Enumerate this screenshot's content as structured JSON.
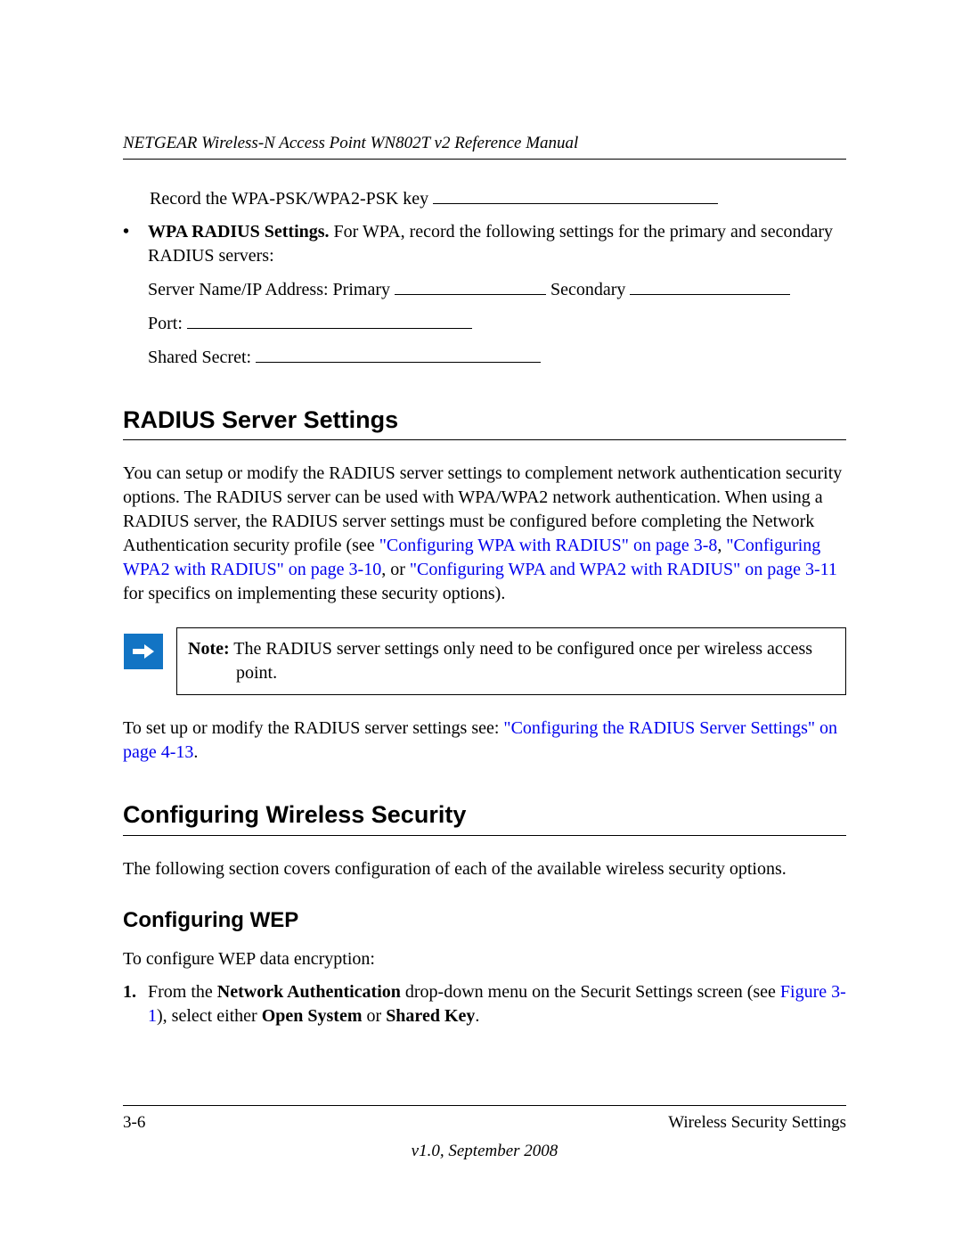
{
  "header": {
    "title": "NETGEAR Wireless-N Access Point WN802T v2 Reference Manual"
  },
  "body": {
    "record_key_line": "Record the WPA-PSK/WPA2-PSK key ",
    "wpa_radius_bold": "WPA RADIUS Settings.",
    "wpa_radius_rest": " For WPA, record the following settings for the primary and secondary RADIUS servers:",
    "server_line_a": "Server Name/IP Address: Primary ",
    "server_line_b": " Secondary ",
    "port_line": "Port: ",
    "shared_secret_line": "Shared Secret: ",
    "h1_radius": "RADIUS Server Settings",
    "radius_para_a": "You can setup or modify the RADIUS server settings to complement network authentication security options. The RADIUS server can be used with WPA/WPA2 network authentication. When using a RADIUS server, the RADIUS server settings must be configured before completing the Network Authentication security profile (see ",
    "radius_link1": "\"Configuring WPA with RADIUS\" on page 3-8",
    "radius_sep1": ", ",
    "radius_link2": "\"Configuring WPA2 with RADIUS\" on page 3-10",
    "radius_sep2": ", or ",
    "radius_link3": "\"Configuring WPA and WPA2 with RADIUS\" on page 3-11",
    "radius_para_b": " for specifics on implementing these security options).",
    "note_bold": "Note:",
    "note_text": " The RADIUS server settings only need to be configured once per wireless access point.",
    "setup_para_a": "To set up or modify the RADIUS server settings see: ",
    "setup_link": "\"Configuring the RADIUS Server Settings\" on page 4-13",
    "setup_para_b": ".",
    "h1_cws": "Configuring Wireless Security",
    "cws_para": "The following section covers configuration of each of the available wireless security options.",
    "h2_wep": "Configuring WEP",
    "wep_intro": "To configure WEP data encryption:",
    "step1_num": "1.",
    "step1_a": "From the ",
    "step1_bold1": "Network Authentication",
    "step1_b": " drop-down menu on the Securit Settings screen (see ",
    "step1_link": "Figure 3-1",
    "step1_c": "), select either ",
    "step1_bold2": "Open System",
    "step1_d": " or ",
    "step1_bold3": "Shared Key",
    "step1_e": "."
  },
  "footer": {
    "page_num": "3-6",
    "section": "Wireless Security Settings",
    "version": "v1.0, September 2008"
  }
}
